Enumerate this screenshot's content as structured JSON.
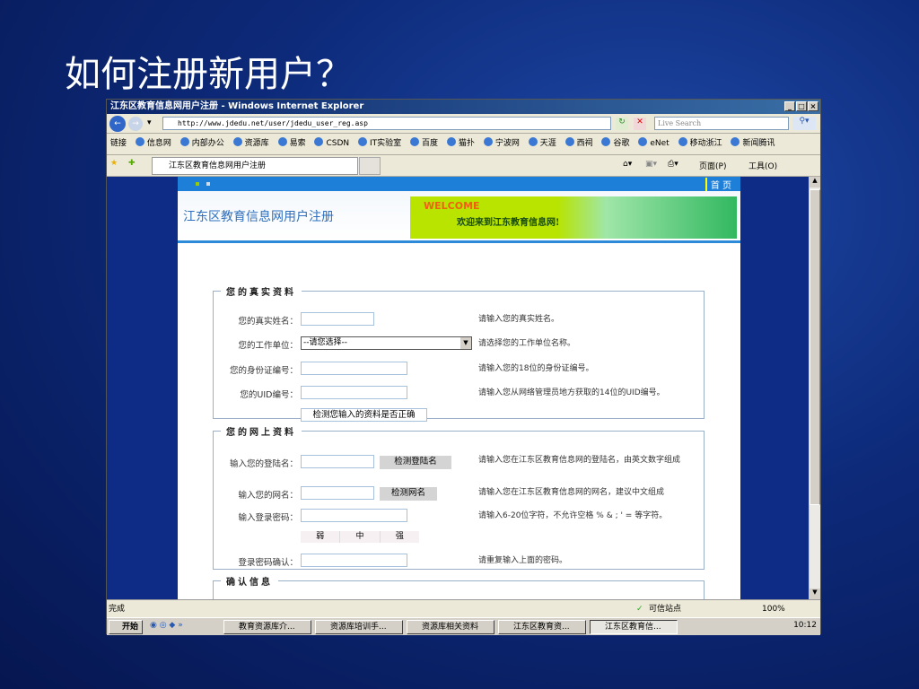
{
  "slide": {
    "title": "如何注册新用户？"
  },
  "browser": {
    "window_title": "江东区教育信息网用户注册 - Windows Internet Explorer",
    "url": "http://www.jdedu.net/user/jdedu_user_reg.asp",
    "search_placeholder": "Live Search",
    "links_label": "链接",
    "links": [
      "信息网",
      "内部办公",
      "资源库",
      "易索",
      "CSDN",
      "IT实验室",
      "百度",
      "猫扑",
      "宁波网",
      "天涯",
      "西祠",
      "谷歌",
      "eNet",
      "移动浙江",
      "新闻腾讯"
    ],
    "tab": "江东区教育信息网用户注册",
    "page_menu": "页面(P)",
    "tools_menu": "工具(O)",
    "status": "完成",
    "zone": "可信站点",
    "zoom": "100%"
  },
  "page": {
    "home_link": "首 页",
    "site_title": "江东区教育信息网用户注册",
    "banner_welcome": "WELCOME",
    "banner_text": "欢迎来到江东教育信息网!",
    "section1": {
      "legend": "您的真实资料",
      "rows": [
        {
          "label": "您的真实姓名：",
          "hint": "请输入您的真实姓名。"
        },
        {
          "label": "您的工作单位：",
          "value": "--请您选择--",
          "hint": "请选择您的工作单位名称。"
        },
        {
          "label": "您的身份证编号：",
          "hint": "请输入您的18位的身份证编号。"
        },
        {
          "label": "您的UID编号：",
          "hint": "请输入您从网络管理员地方获取的14位的UID编号。"
        }
      ],
      "check_button": "检测您输入的资料是否正确"
    },
    "section2": {
      "legend": "您的网上资料",
      "rows": [
        {
          "label": "输入您的登陆名：",
          "button": "检测登陆名",
          "hint": "请输入您在江东区教育信息网的登陆名，由英文数字组成"
        },
        {
          "label": "输入您的网名：",
          "button": "检测网名",
          "hint": "请输入您在江东区教育信息网的网名，建议中文组成"
        },
        {
          "label": "输入登录密码：",
          "hint": "请输入6-20位字符，不允许空格 % & ; ' = 等字符。"
        },
        {
          "label": "登录密码确认：",
          "hint": "请重复输入上面的密码。"
        }
      ],
      "strength": [
        "弱",
        "中",
        "强"
      ]
    },
    "section3": {
      "legend": "确认信息"
    }
  },
  "taskbar": {
    "start": "开始",
    "items": [
      "教育资源库介...",
      "资源库培训手...",
      "资源库相关资料",
      "江东区教育资...",
      "江东区教育信..."
    ],
    "clock": "10:12"
  }
}
